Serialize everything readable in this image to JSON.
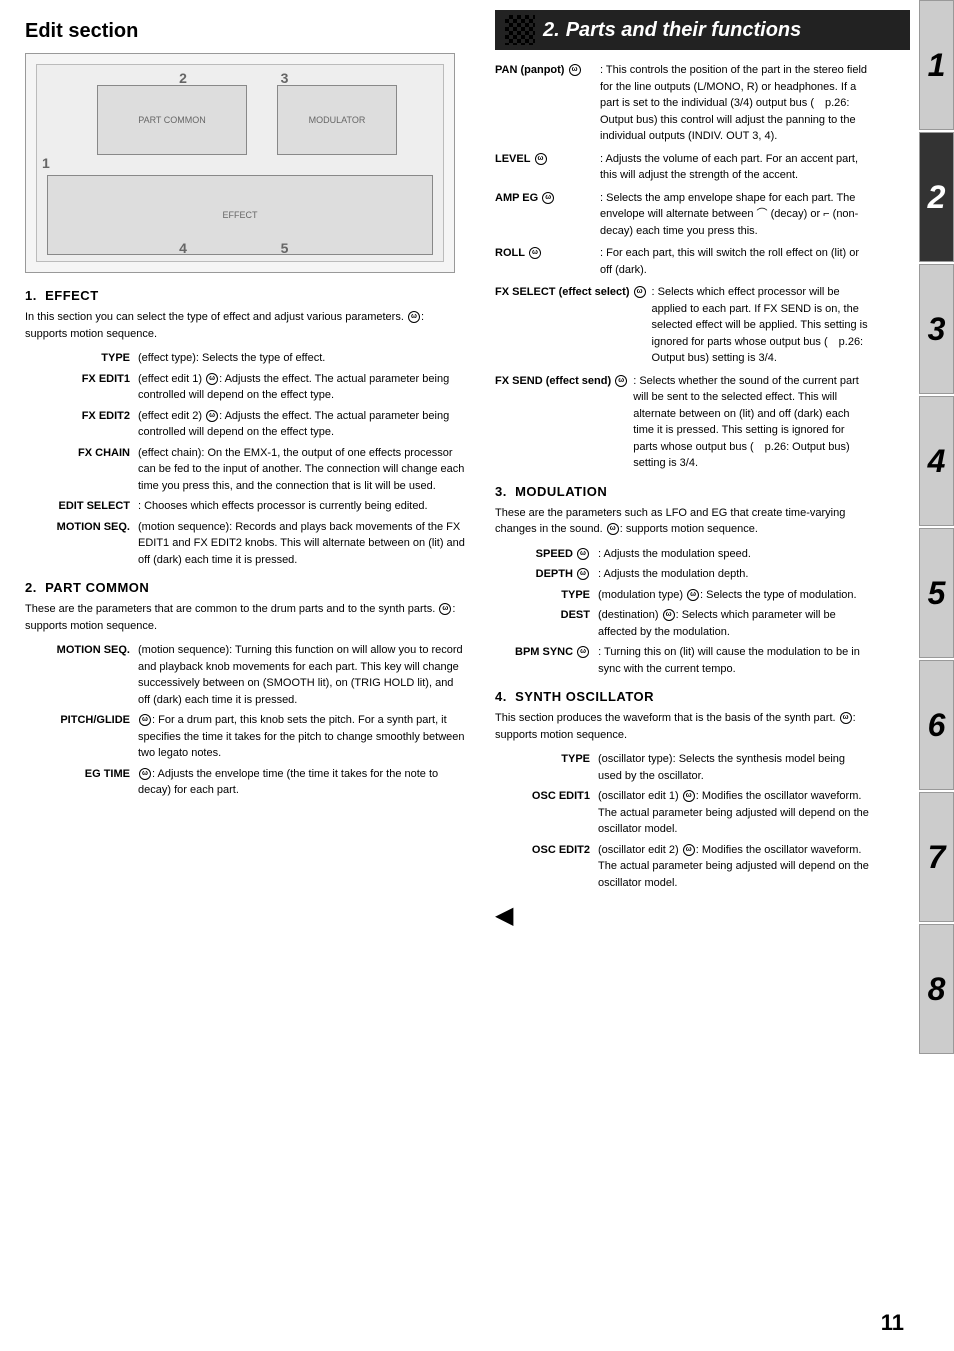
{
  "page": {
    "number": "11",
    "title": "Parts and their functions",
    "chapter_number": "2."
  },
  "left": {
    "edit_section_title": "Edit section",
    "diagram": {
      "label1": "1",
      "label2": "2",
      "label3": "3",
      "label4": "4",
      "label5": "5"
    },
    "sections": [
      {
        "number": "1.",
        "title": "EFFECT",
        "intro": "In this section you can select the type of effect and adjust various parameters. ⓦ: supports motion sequence.",
        "terms": [
          {
            "label": "TYPE",
            "desc": "(effect type): Selects the type of effect."
          },
          {
            "label": "FX EDIT1",
            "desc": "(effect edit 1) ⓦ: Adjusts the effect. The actual parameter being controlled will depend on the effect type."
          },
          {
            "label": "FX EDIT2",
            "desc": "(effect edit 2) ⓦ: Adjusts the effect. The actual parameter being controlled will depend on the effect type."
          },
          {
            "label": "FX CHAIN",
            "desc": "(effect chain): On the EMX-1, the output of one effects processor can be fed to the input of another. The connection will change each time you press this, and the connection that is lit will be used."
          },
          {
            "label": "EDIT SELECT",
            "desc": ": Chooses which effects processor is currently being edited."
          },
          {
            "label": "MOTION SEQ.",
            "desc": "(motion sequence): Records and plays back movements of the FX EDIT1 and FX EDIT2 knobs. This will alternate between on (lit) and off (dark) each time it is pressed."
          }
        ]
      },
      {
        "number": "2.",
        "title": "PART COMMON",
        "intro": "These are the parameters that are common to the drum parts and to the synth parts. ⓦ: supports motion sequence.",
        "terms": [
          {
            "label": "MOTION SEQ.",
            "desc": "(motion sequence): Turning this function on will allow you to record and playback knob movements for each part. This key will change successively between on (SMOOTH lit), on (TRIG HOLD lit), and off (dark) each time it is pressed."
          },
          {
            "label": "PITCH/GLIDE",
            "desc": "ⓦ: For a drum part, this knob sets the pitch. For a synth part, it specifies the time it takes for the pitch to change smoothly between two legato notes."
          },
          {
            "label": "EG TIME",
            "desc": "ⓦ: Adjusts the envelope time (the time it takes for the note to decay) for each part."
          }
        ]
      }
    ]
  },
  "right": {
    "header_number": "2.",
    "header_title": "Parts and their functions",
    "terms": [
      {
        "label": "PAN",
        "label_extra": "(panpot) ⓦ",
        "desc": ": This controls the position of the part in the stereo field for the line outputs (L/MONO, R) or headphones. If a part is set to the individual (3/4) output bus (p.26: Output bus) this control will adjust the panning to the individual outputs (INDIV. OUT 3, 4)."
      },
      {
        "label": "LEVEL",
        "label_extra": "ⓦ",
        "desc": ": Adjusts the volume of each part. For an accent part, this will adjust the strength of the accent."
      },
      {
        "label": "AMP EG",
        "label_extra": "ⓦ",
        "desc": ": Selects the amp envelope shape for each part. The envelope will alternate between (decay) or (non-decay) each time you press this."
      },
      {
        "label": "ROLL",
        "label_extra": "ⓦ",
        "desc": ": For each part, this will switch the roll effect on (lit) or off (dark)."
      },
      {
        "label": "FX SELECT",
        "label_extra": "(effect select) ⓦ",
        "desc": ": Selects which effect processor will be applied to each part. If FX SEND is on, the selected effect will be applied. This setting is ignored for parts whose output bus (p.26: Output bus) setting is 3/4."
      },
      {
        "label": "FX SEND",
        "label_extra": "(effect send) ⓦ",
        "desc": ": Selects whether the sound of the current part will be sent to the selected effect. This will alternate between on (lit) and off (dark) each time it is pressed. This setting is ignored for parts whose output bus (p.26: Output bus) setting is 3/4."
      }
    ],
    "sections": [
      {
        "number": "3.",
        "title": "MODULATION",
        "intro": "These are the parameters such as LFO and EG that create time-varying changes in the sound. ⓦ: supports motion sequence.",
        "terms": [
          {
            "label": "SPEED",
            "label_extra": "ⓦ",
            "desc": ": Adjusts the modulation speed."
          },
          {
            "label": "DEPTH",
            "label_extra": "ⓦ",
            "desc": ": Adjusts the modulation depth."
          },
          {
            "label": "TYPE",
            "label_extra": "(modulation type) ⓦ",
            "desc": ": Selects the type of modulation."
          },
          {
            "label": "DEST",
            "label_extra": "(destination) ⓦ",
            "desc": ": Selects which parameter will be affected by the modulation."
          },
          {
            "label": "BPM SYNC",
            "label_extra": "ⓦ",
            "desc": ": Turning this on (lit) will cause the modulation to be in sync with the current tempo."
          }
        ]
      },
      {
        "number": "4.",
        "title": "SYNTH OSCILLATOR",
        "intro": "This section produces the waveform that is the basis of the synth part. ⓦ: supports motion sequence.",
        "terms": [
          {
            "label": "TYPE",
            "label_extra": "(oscillator type)",
            "desc": ": Selects the synthesis model being used by the oscillator."
          },
          {
            "label": "OSC EDIT1",
            "label_extra": "(oscillator edit 1) ⓦ",
            "desc": ": Modifies the oscillator waveform. The actual parameter being adjusted will depend on the oscillator model."
          },
          {
            "label": "OSC EDIT2",
            "label_extra": "(oscillator edit 2) ⓦ",
            "desc": ": Modifies the oscillator waveform. The actual parameter being adjusted will depend on the oscillator model."
          }
        ]
      }
    ]
  },
  "tabs": [
    {
      "number": "1",
      "active": false
    },
    {
      "number": "2",
      "active": true
    },
    {
      "number": "3",
      "active": false
    },
    {
      "number": "4",
      "active": false
    },
    {
      "number": "5",
      "active": false
    },
    {
      "number": "6",
      "active": false
    },
    {
      "number": "7",
      "active": false
    },
    {
      "number": "8",
      "active": false
    }
  ]
}
